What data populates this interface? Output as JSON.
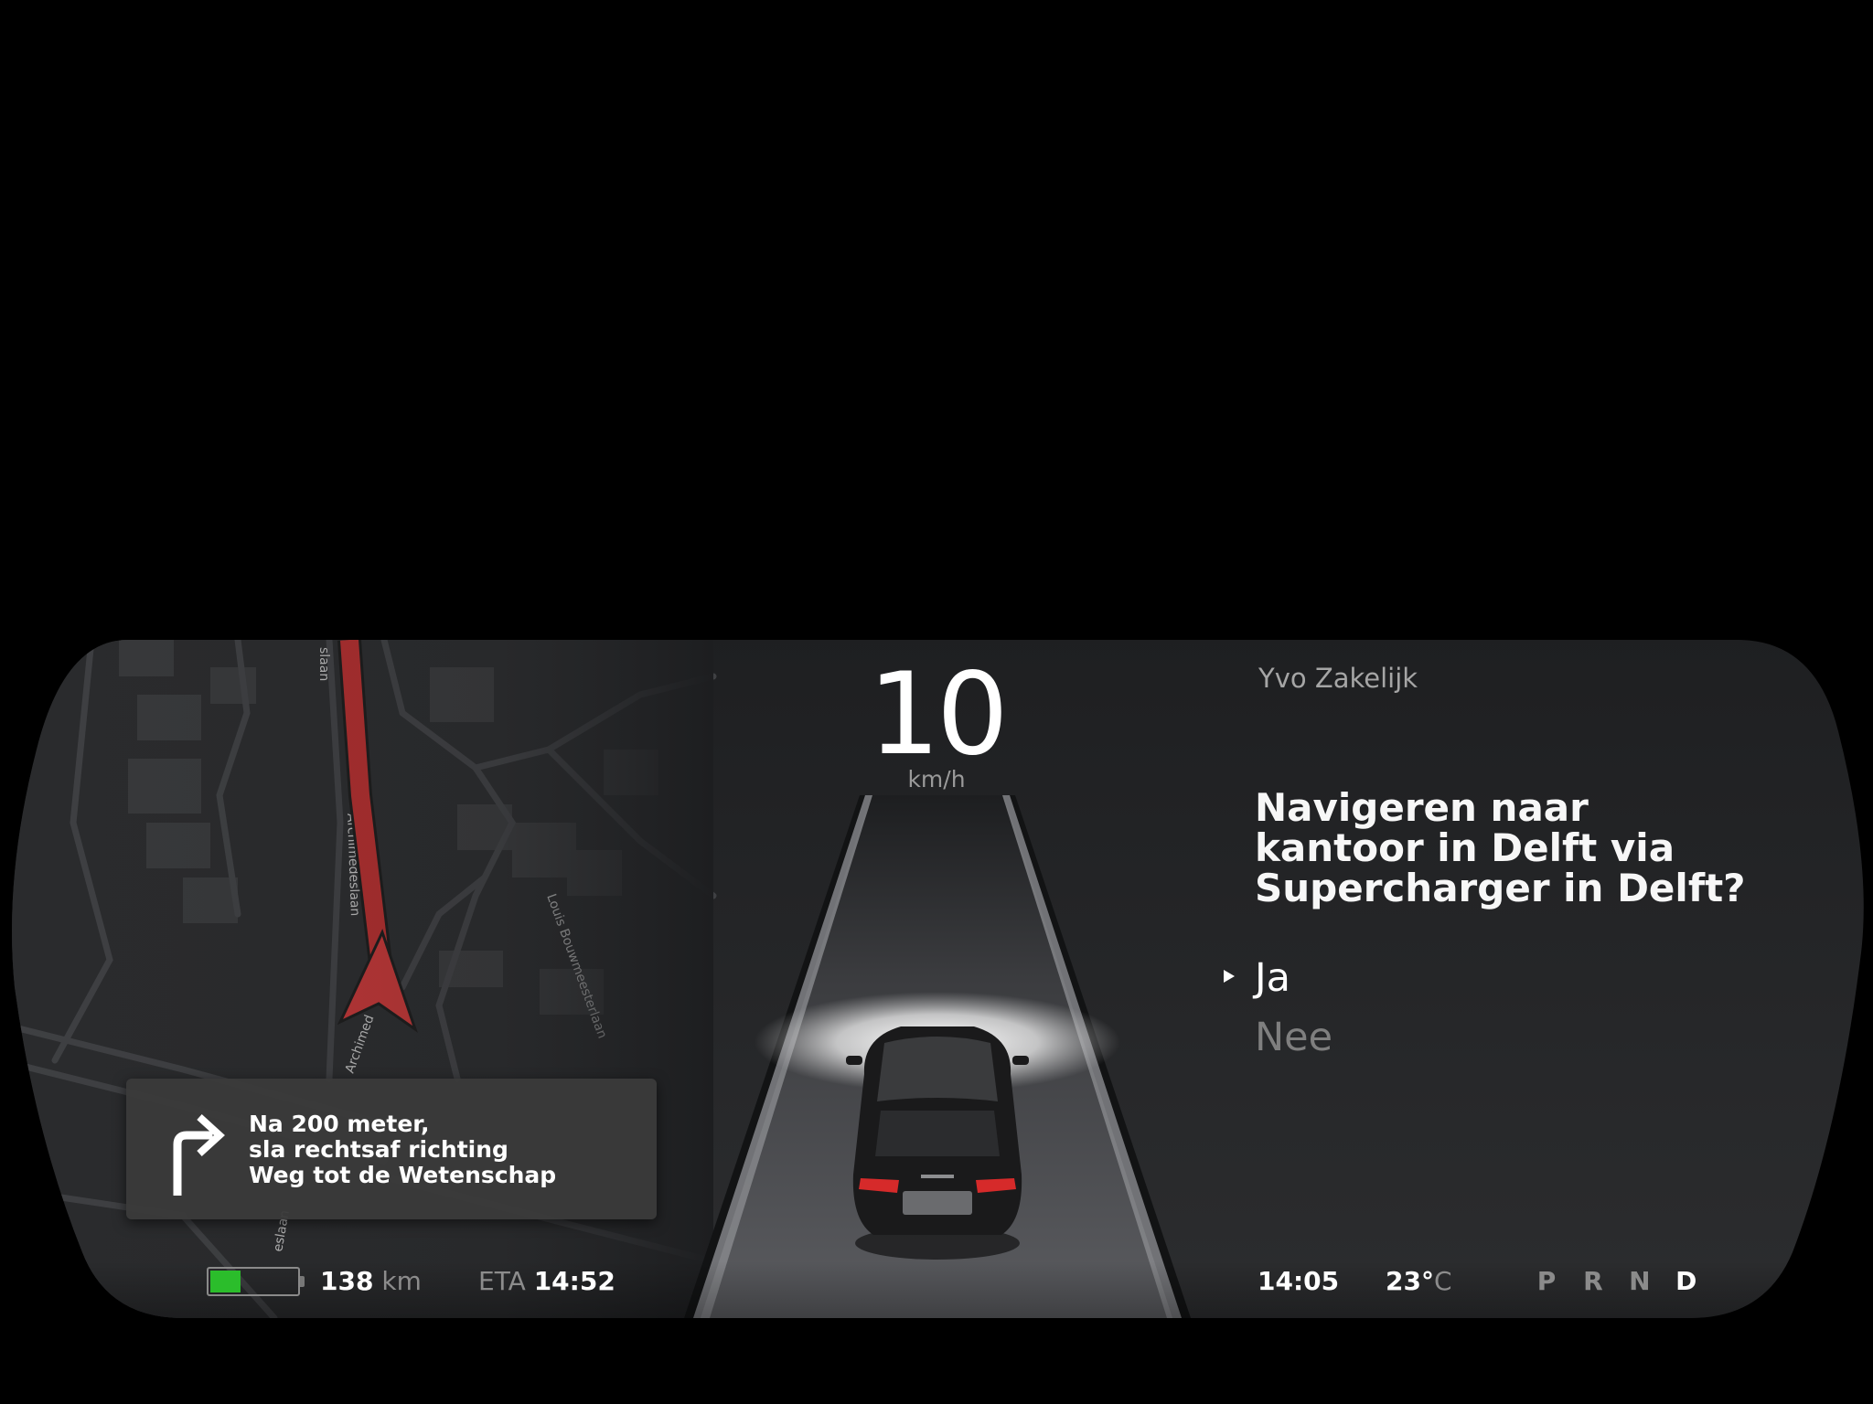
{
  "speed": {
    "value": "10",
    "unit": "km/h"
  },
  "call": {
    "caller": "Yvo Zakelijk",
    "question": [
      "Navigeren naar",
      "kantoor in Delft via",
      "Supercharger in Delft?"
    ],
    "options": [
      {
        "label": "Ja",
        "selected": true
      },
      {
        "label": "Nee",
        "selected": false
      }
    ]
  },
  "navigation": {
    "instruction": [
      "Na 200 meter,",
      "sla rechtsaf richting",
      "Weg tot de Wetenschap"
    ],
    "maneuver_icon": "turn-right-arrow-icon",
    "streets": [
      "Archimedeslaan",
      "Louis Bouwmeesterlaan",
      "Archimed",
      "eslaan",
      "slaan"
    ],
    "route_color": "#b32e2e"
  },
  "status": {
    "battery_level": 0.35,
    "battery_color": "#2bbd2b",
    "range_value": "138",
    "range_unit": "km",
    "eta_label": "ETA",
    "eta_value": "14:52",
    "time": "14:05",
    "temperature_value": "23°",
    "temperature_unit": "C",
    "gears": [
      {
        "label": "P",
        "active": false
      },
      {
        "label": "R",
        "active": false
      },
      {
        "label": "N",
        "active": false
      },
      {
        "label": "D",
        "active": true
      }
    ]
  }
}
